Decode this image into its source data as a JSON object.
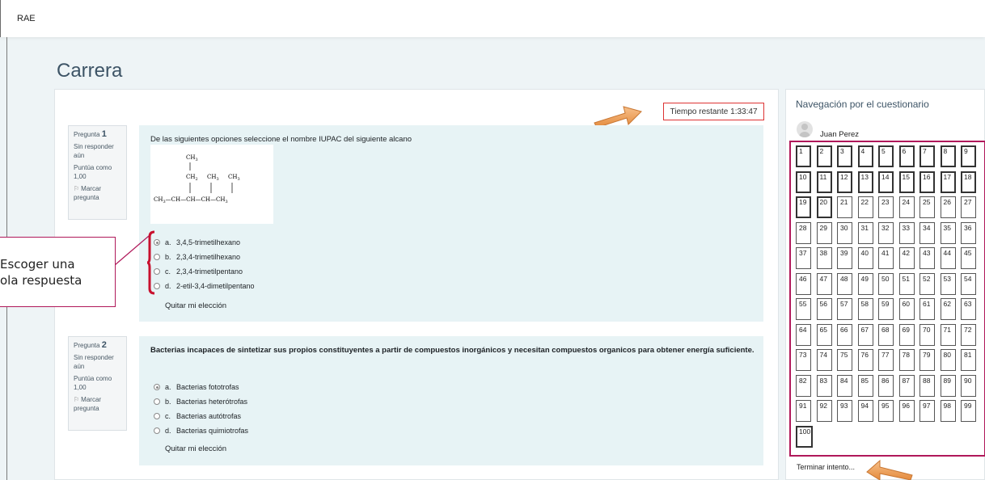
{
  "header": {
    "brand": "RAE"
  },
  "page_title": "Carrera",
  "timer": {
    "label": "Tiempo restante 1:33:47"
  },
  "questions": [
    {
      "info": {
        "label": "Pregunta",
        "number": "1",
        "status": "Sin responder aún",
        "grade": "Puntúa como 1,00",
        "flag": "Marcar pregunta"
      },
      "text": "De las siguientes opciones seleccione el nombre IUPAC del siguiente alcano",
      "molecule": {
        "ch3": "CH",
        "sub": "3",
        "ch2": "CH",
        "sub2": "2",
        "ch": "CH"
      },
      "answers": [
        {
          "letter": "a.",
          "text": "3,4,5-trimetilhexano",
          "checked": true
        },
        {
          "letter": "b.",
          "text": "2,3,4-trimetilhexano",
          "checked": false
        },
        {
          "letter": "c.",
          "text": "2,3,4-trimetilpentano",
          "checked": false
        },
        {
          "letter": "d.",
          "text": "2-etil-3,4-dimetilpentano",
          "checked": false
        }
      ],
      "clear": "Quitar mi elección"
    },
    {
      "info": {
        "label": "Pregunta",
        "number": "2",
        "status": "Sin responder aún",
        "grade": "Puntúa como 1,00",
        "flag": "Marcar pregunta"
      },
      "text": "Bacterias incapaces de sintetizar sus propios constituyentes a partir de compuestos inorgánicos y necesitan compuestos organicos para obtener energía suficiente.",
      "answers": [
        {
          "letter": "a.",
          "text": "Bacterias fototrofas",
          "checked": true
        },
        {
          "letter": "b.",
          "text": "Bacterias heterótrofas",
          "checked": false
        },
        {
          "letter": "c.",
          "text": "Bacterias autótrofas",
          "checked": false
        },
        {
          "letter": "d.",
          "text": "Bacterias quimiotrofas",
          "checked": false
        }
      ],
      "clear": "Quitar mi elección"
    }
  ],
  "callout": {
    "line1": "Escoger una",
    "line2": "ola respuesta"
  },
  "navigation": {
    "title": "Navegación por el cuestionario",
    "user": "Juan Perez",
    "buttons": [
      "1",
      "2",
      "3",
      "4",
      "5",
      "6",
      "7",
      "8",
      "9",
      "10",
      "11",
      "12",
      "13",
      "14",
      "15",
      "16",
      "17",
      "18",
      "19",
      "20",
      "21",
      "22",
      "23",
      "24",
      "25",
      "26",
      "27",
      "28",
      "29",
      "30",
      "31",
      "32",
      "33",
      "34",
      "35",
      "36",
      "37",
      "38",
      "39",
      "40",
      "41",
      "42",
      "43",
      "44",
      "45",
      "46",
      "47",
      "48",
      "49",
      "50",
      "51",
      "52",
      "53",
      "54",
      "55",
      "56",
      "57",
      "58",
      "59",
      "60",
      "61",
      "62",
      "63",
      "64",
      "65",
      "66",
      "67",
      "68",
      "69",
      "70",
      "71",
      "72",
      "73",
      "74",
      "75",
      "76",
      "77",
      "78",
      "79",
      "80",
      "81",
      "82",
      "83",
      "84",
      "85",
      "86",
      "87",
      "88",
      "89",
      "90",
      "91",
      "92",
      "93",
      "94",
      "95",
      "96",
      "97",
      "98",
      "99",
      "100"
    ],
    "finish": "Terminar intento..."
  },
  "colors": {
    "accent": "#b0185a",
    "timer_border": "#dd3333",
    "arrow": "#f0a055"
  }
}
